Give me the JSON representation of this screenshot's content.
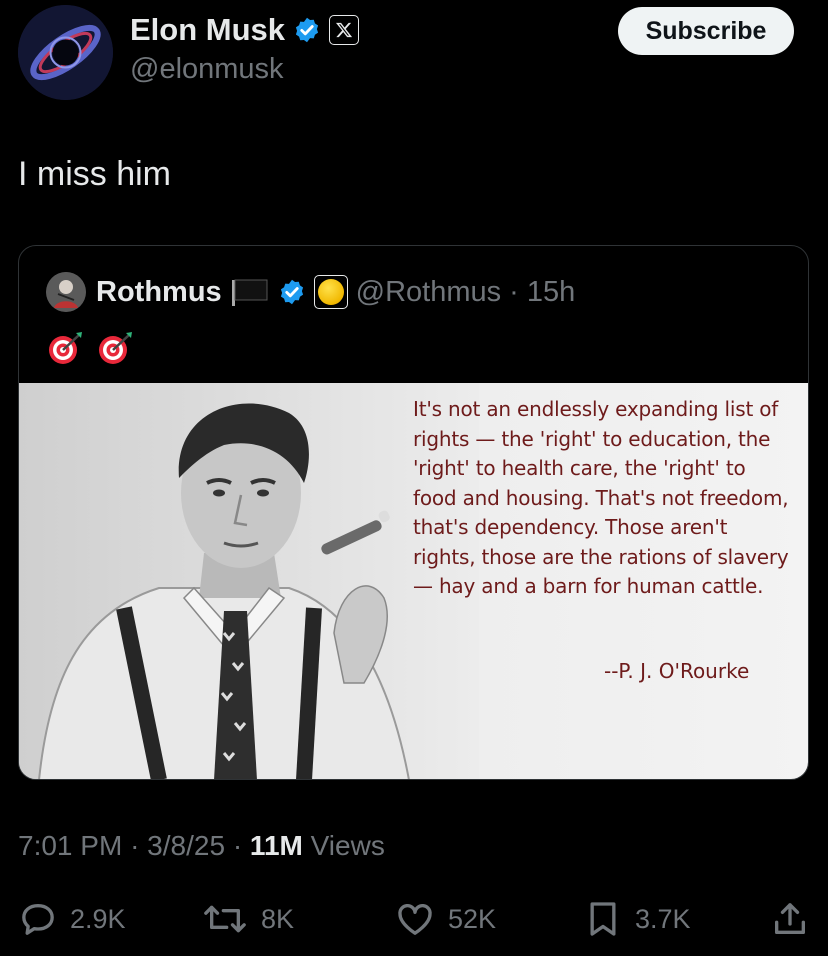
{
  "author": {
    "name": "Elon Musk",
    "handle": "@elonmusk",
    "subscribe_label": "Subscribe"
  },
  "tweet": {
    "text": "I miss him"
  },
  "quoted": {
    "name": "Rothmus",
    "handle": "@Rothmus",
    "separator": "·",
    "time": "15h",
    "image_quote": "It's not an endlessly expanding list of rights — the 'right' to education, the 'right' to health care, the 'right' to food and housing. That's not freedom, that's dependency. Those aren't rights, those are the rations of slavery — hay and a barn for human cattle.",
    "image_attribution": "--P. J. O'Rourke"
  },
  "meta": {
    "time": "7:01 PM",
    "date": "3/8/25",
    "views_count": "11M",
    "views_label": "Views",
    "separator": "·"
  },
  "actions": {
    "replies": "2.9K",
    "reposts": "8K",
    "likes": "52K",
    "bookmarks": "3.7K"
  },
  "colors": {
    "background": "#000000",
    "text_primary": "#e7e9ea",
    "text_secondary": "#71767b",
    "verified_blue": "#1d9bf0",
    "quote_text": "#6e1b1b"
  },
  "icons": {
    "verified": "verified-badge-icon",
    "x_logo": "x-logo-icon",
    "flag": "black-flag-icon",
    "coin": "yellow-circle-icon",
    "emoji": "direct-hit-target-icon",
    "reply": "reply-bubble-icon",
    "repost": "repost-icon",
    "like": "heart-icon",
    "bookmark": "bookmark-icon",
    "share": "share-icon"
  }
}
